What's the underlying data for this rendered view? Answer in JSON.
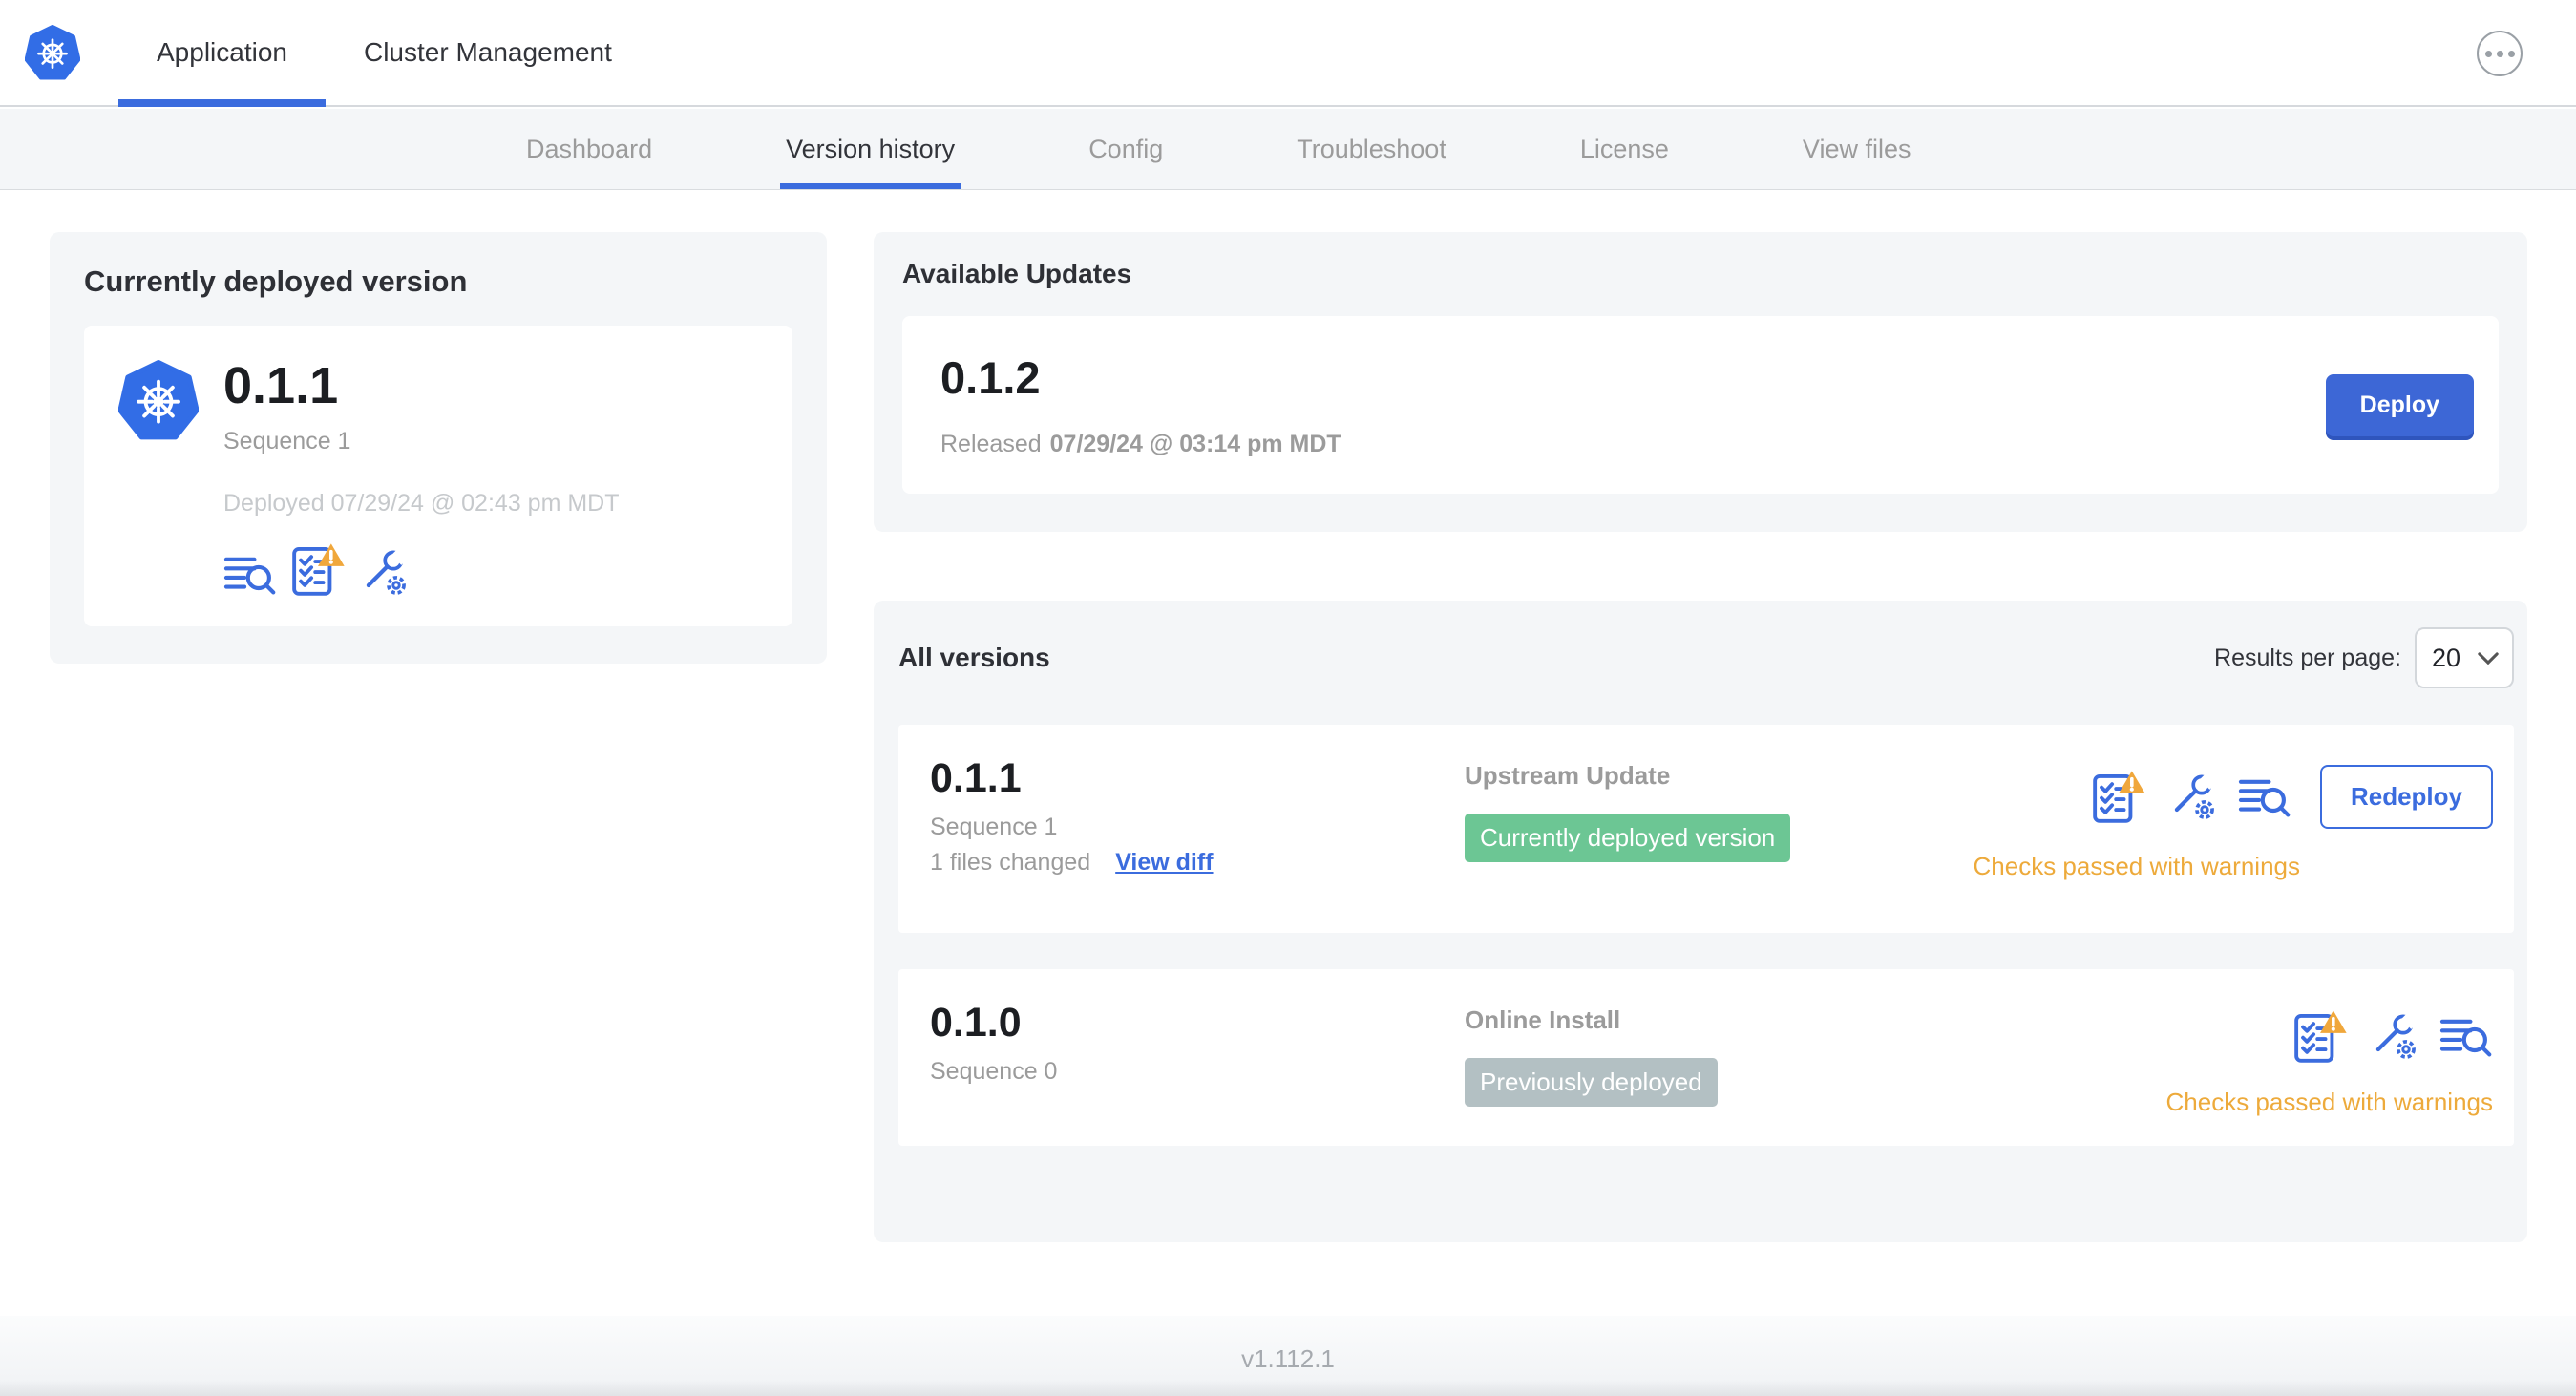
{
  "header": {
    "logo_icon": "kubernetes-logo",
    "tabs": [
      {
        "label": "Application",
        "active": true
      },
      {
        "label": "Cluster Management",
        "active": false
      }
    ],
    "more_icon": "more-options-icon"
  },
  "subnav": {
    "tabs": [
      {
        "label": "Dashboard",
        "active": false
      },
      {
        "label": "Version history",
        "active": true
      },
      {
        "label": "Config",
        "active": false
      },
      {
        "label": "Troubleshoot",
        "active": false
      },
      {
        "label": "License",
        "active": false
      },
      {
        "label": "View files",
        "active": false
      }
    ]
  },
  "current_version": {
    "title": "Currently deployed version",
    "version": "0.1.1",
    "sequence": "Sequence 1",
    "deployed": "Deployed 07/29/24 @ 02:43 pm MDT",
    "icons": [
      "logs-icon",
      "preflight-checks-warning-icon",
      "config-icon"
    ]
  },
  "available_updates": {
    "title": "Available Updates",
    "version": "0.1.2",
    "released_prefix": "Released",
    "released_date": "07/29/24 @ 03:14 pm MDT",
    "deploy_label": "Deploy"
  },
  "all_versions": {
    "title": "All versions",
    "results_per_page_label": "Results per page:",
    "results_per_page_value": "20",
    "rows": [
      {
        "version": "0.1.1",
        "sequence": "Sequence 1",
        "files_changed": "1 files changed",
        "view_diff_label": "View diff",
        "source": "Upstream Update",
        "badge": "Currently deployed version",
        "badge_color": "#6cc694",
        "status": "Checks passed with warnings",
        "action_label": "Redeploy",
        "icons": [
          "preflight-checks-warning-icon",
          "config-icon",
          "logs-icon"
        ]
      },
      {
        "version": "0.1.0",
        "sequence": "Sequence 0",
        "source": "Online Install",
        "badge": "Previously deployed",
        "badge_color": "#b3c0c3",
        "status": "Checks passed with warnings",
        "icons": [
          "preflight-checks-warning-icon",
          "config-icon",
          "logs-icon"
        ]
      }
    ]
  },
  "footer": {
    "app_version": "v1.112.1"
  },
  "colors": {
    "accent_blue": "#3b6cde",
    "k8s_blue": "#326de6",
    "deploy_button_blue": "#3d67d6",
    "badge_green": "#6cc694",
    "badge_gray": "#b3c0c3",
    "warning_amber": "#edaa3b",
    "card_bg": "#f4f6f8",
    "text_dark": "#32343a",
    "text_gray": "#9b9b9b",
    "text_light_gray": "#c6c9cc"
  }
}
